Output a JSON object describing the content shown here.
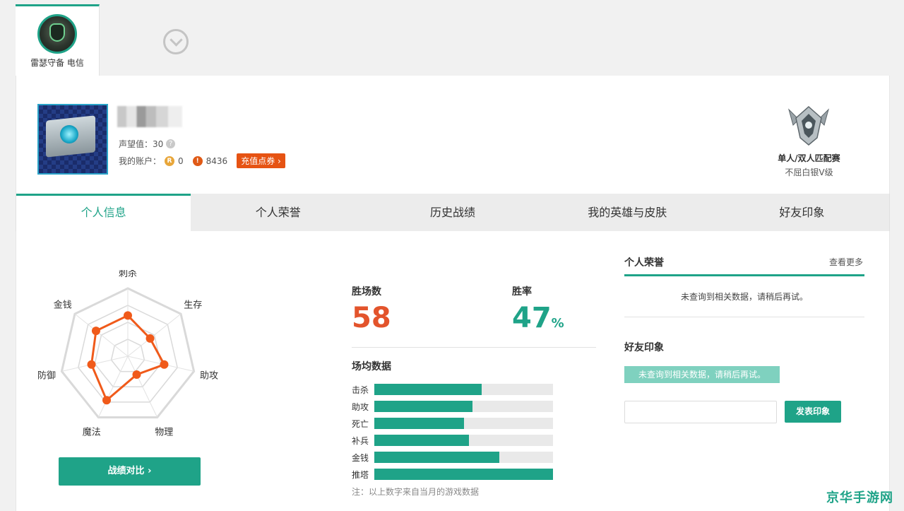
{
  "server": {
    "label": "雷瑟守备 电信"
  },
  "profile": {
    "reputation_label": "声望值：30",
    "account_label": "我的账户：",
    "r_coin_icon": "R",
    "r_coin_value": "0",
    "p_coin_icon": "!",
    "p_coin_value": "8436",
    "recharge_label": "充值点券 ›"
  },
  "rank": {
    "queue": "单人/双人匹配赛",
    "tier": "不屈白银V级"
  },
  "tabs": [
    {
      "label": "个人信息",
      "active": true
    },
    {
      "label": "个人荣誉",
      "active": false
    },
    {
      "label": "历史战绩",
      "active": false
    },
    {
      "label": "我的英雄与皮肤",
      "active": false
    },
    {
      "label": "好友印象",
      "active": false
    }
  ],
  "radar": {
    "axes": [
      "刺杀",
      "生存",
      "助攻",
      "物理",
      "魔法",
      "防御",
      "金钱"
    ],
    "values": [
      0.6,
      0.42,
      0.55,
      0.3,
      0.72,
      0.55,
      0.6
    ]
  },
  "stats": {
    "wins_label": "胜场数",
    "wins_value": "58",
    "rate_label": "胜率",
    "rate_value": "47",
    "rate_unit": "%",
    "avg_title": "场均数据",
    "bars": [
      {
        "label": "击杀",
        "value": 0.6
      },
      {
        "label": "助攻",
        "value": 0.55
      },
      {
        "label": "死亡",
        "value": 0.5
      },
      {
        "label": "补兵",
        "value": 0.53
      },
      {
        "label": "金钱",
        "value": 0.7
      },
      {
        "label": "推塔",
        "value": 1.0
      }
    ],
    "note": "注：以上数字来自当月的游戏数据"
  },
  "compare_button": "战绩对比 ›",
  "honors": {
    "title": "个人荣誉",
    "see_more": "查看更多",
    "empty": "未查询到相关数据，请稍后再试。"
  },
  "friends": {
    "title": "好友印象",
    "empty": "未查询到相关数据，请稍后再试。",
    "input_placeholder": "",
    "publish": "发表印象"
  },
  "watermark": "京华手游网",
  "colors": {
    "accent": "#1fa388",
    "wins": "#e3542c",
    "radar_line": "#f05a1a",
    "recharge": "#e65313"
  }
}
